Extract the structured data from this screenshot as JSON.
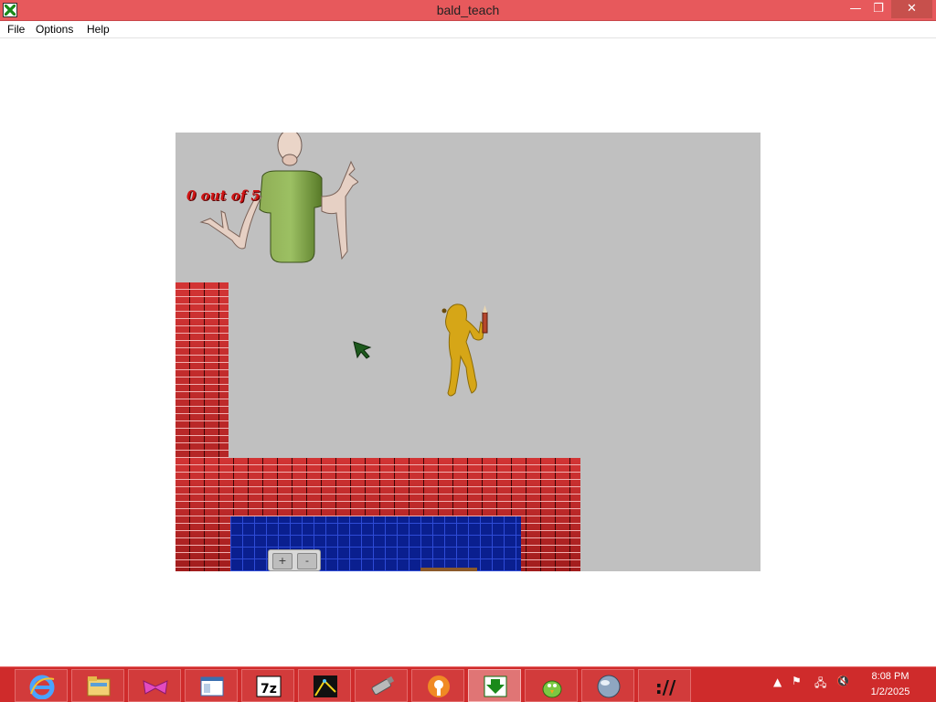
{
  "window": {
    "title": "bald_teach",
    "controls": {
      "minimize": "—",
      "maximize": "❐",
      "close": "✕"
    }
  },
  "menu": {
    "file": "File",
    "options": "Options",
    "help": "Help"
  },
  "game": {
    "counter": "0 out of 5",
    "zoom_plus": "+",
    "zoom_minus": "-"
  },
  "taskbar": {
    "apps": [
      "internet-explorer",
      "file-explorer",
      "paint-app",
      "window-app",
      "7zip",
      "inkscape",
      "usb-drive",
      "firefox-like",
      "bald-teach",
      "green-bird",
      "sphere-app",
      "terminal-slashes"
    ],
    "active_app": "bald-teach",
    "time": "8:08 PM",
    "date": "1/2/2025",
    "icon_7zip_label": "7z",
    "icon_term_label": "://"
  },
  "colors": {
    "titlebar": "#e7595c",
    "taskbar": "#cf2b2b",
    "game_bg": "#c0c0c0"
  }
}
